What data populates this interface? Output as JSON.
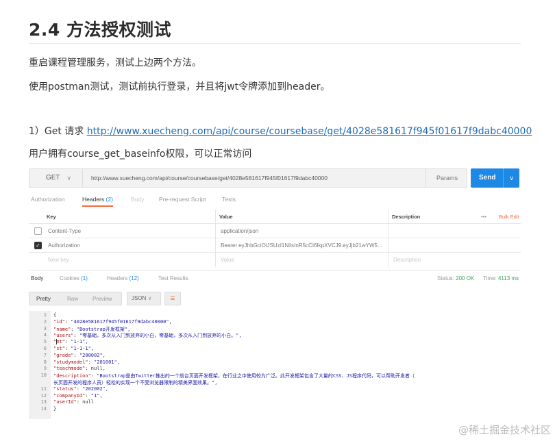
{
  "heading": "2.4 方法授权测试",
  "para1": "重启课程管理服务，测试上边两个方法。",
  "para2": "使用postman测试，测试前执行登录，并且将jwt令牌添加到header。",
  "para3_prefix": "1）Get 请求 ",
  "para3_link": "http://www.xuecheng.com/api/course/coursebase/get/4028e581617f945f01617f9dabc40000",
  "para4": "用户拥有course_get_baseinfo权限，可以正常访问",
  "postman": {
    "method": "GET",
    "url": "http://www.xuecheng.com/api/course/coursebase/get/4028e581617f945f01617f9dabc40000",
    "params_label": "Params",
    "send_label": "Send",
    "req_tabs": {
      "authorization": "Authorization",
      "headers": "Headers",
      "headers_count": "(2)",
      "body": "Body",
      "prerequest": "Pre-request Script",
      "tests": "Tests"
    },
    "kv_headers": {
      "key": "Key",
      "value": "Value",
      "description": "Description",
      "dots": "•••",
      "bulk": "Bulk Edit"
    },
    "kv_rows": [
      {
        "key": "Content-Type",
        "value": "application/json",
        "checked": false
      },
      {
        "key": "Authorization",
        "value": "Bearer eyJhbGciOiJSUzI1NiIsInR5cCI6IkpXVCJ9.eyJjb21wYW5...",
        "checked": true
      }
    ],
    "kv_placeholder": {
      "key": "New key",
      "value": "Value",
      "description": "Description"
    },
    "resp_tabs": {
      "body": "Body",
      "cookies": "Cookies",
      "cookies_count": "(1)",
      "headers": "Headers",
      "headers_count": "(12)",
      "tests": "Test Results"
    },
    "status_label": "Status:",
    "status_value": "200 OK",
    "time_label": "Time:",
    "time_value": "4113 ms",
    "view_modes": {
      "pretty": "Pretty",
      "raw": "Raw",
      "preview": "Preview"
    },
    "format": "JSON",
    "code_lines": [
      {
        "n": "1",
        "text": "{"
      },
      {
        "n": "2",
        "text": "    \"id\": \"4028e581617f945f01617f9dabc40000\","
      },
      {
        "n": "3",
        "text": "    \"name\": \"Bootstrap开发框架\","
      },
      {
        "n": "4",
        "text": "    \"users\": \"零基础，多次从入门到放弃的小白，零基础，多次从入门到放弃的小白。\","
      },
      {
        "n": "5",
        "text": "    \"mt\": \"1-1\","
      },
      {
        "n": "6",
        "text": "    \"st\": \"1-1-1\","
      },
      {
        "n": "7",
        "text": "    \"grade\": \"200002\","
      },
      {
        "n": "8",
        "text": "    \"studymodel\": \"201001\","
      },
      {
        "n": "9",
        "text": "    \"teachmode\": null,"
      },
      {
        "n": "10",
        "text": "    \"description\": \"Bootstrap是由Twitter推出的一个前台页面开发框架，在行业之中使用较为广泛。此开发框架包含了大量的CSS、JS程序代码，可以帮助开发者（"
      },
      {
        "n": "",
        "text": "        长页面开发的程序人员）轻松的实现一个不受浏览器限制的精美界面效果。\","
      },
      {
        "n": "11",
        "text": "    \"status\": \"202002\","
      },
      {
        "n": "12",
        "text": "    \"companyId\": \"1\","
      },
      {
        "n": "13",
        "text": "    \"userId\": null"
      },
      {
        "n": "14",
        "text": "}"
      }
    ]
  },
  "watermark": "@稀土掘金技术社区"
}
